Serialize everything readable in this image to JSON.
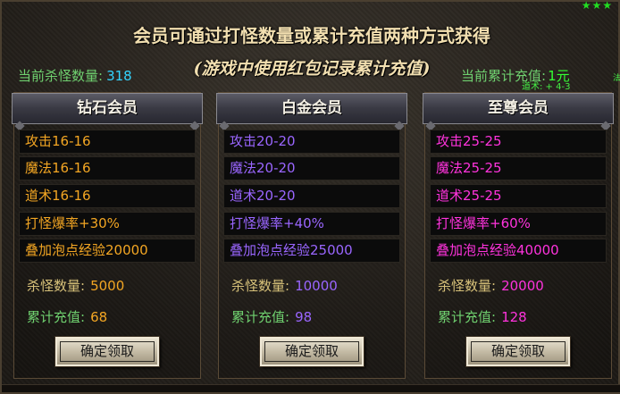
{
  "header": {
    "stars": "★★★",
    "line1": "会员可通过打怪数量或累计充值两种方式获得",
    "line2": "(游戏中使用红包记录累计充值)"
  },
  "stats": {
    "kills_label": "当前杀怪数量:",
    "kills_value": "318",
    "recharge_label": "当前累计充值:",
    "recharge_value": "1元"
  },
  "overlay_text": {
    "tiny1": "法",
    "tiny2": "道术: + 4-3"
  },
  "colors": {
    "diamond": "#f3a623",
    "platinum": "#9a66ff",
    "supreme": "#ff33dd",
    "green_label": "#6fd06f"
  },
  "columns": [
    {
      "title": "钻石会员",
      "attrs": [
        "攻击16-16",
        "魔法16-16",
        "道术16-16",
        "打怪爆率+30%",
        "叠加泡点经验20000"
      ],
      "kill_label": "杀怪数量:",
      "kill_value": "5000",
      "recharge_label": "累计充值:",
      "recharge_value": "68",
      "button": "确定领取"
    },
    {
      "title": "白金会员",
      "attrs": [
        "攻击20-20",
        "魔法20-20",
        "道术20-20",
        "打怪爆率+40%",
        "叠加泡点经验25000"
      ],
      "kill_label": "杀怪数量:",
      "kill_value": "10000",
      "recharge_label": "累计充值:",
      "recharge_value": "98",
      "button": "确定领取"
    },
    {
      "title": "至尊会员",
      "attrs": [
        "攻击25-25",
        "魔法25-25",
        "道术25-25",
        "打怪爆率+60%",
        "叠加泡点经验40000"
      ],
      "kill_label": "杀怪数量:",
      "kill_value": "20000",
      "recharge_label": "累计充值:",
      "recharge_value": "128",
      "button": "确定领取"
    }
  ]
}
